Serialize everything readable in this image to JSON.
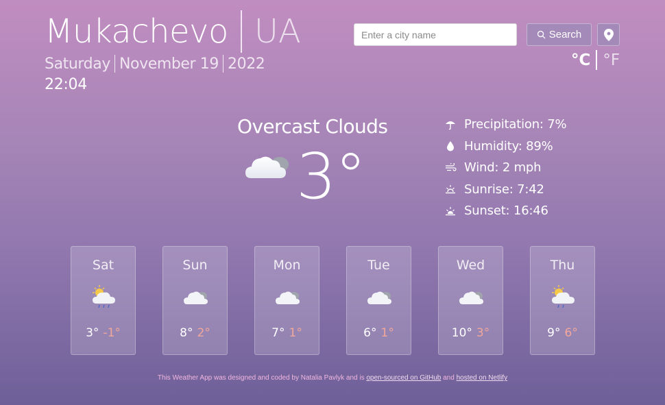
{
  "location": {
    "city": "Mukachevo",
    "country": "UA"
  },
  "date": {
    "weekday": "Saturday",
    "month_day": "November 19",
    "year": "2022",
    "time": "22:04"
  },
  "search": {
    "placeholder": "Enter a city name",
    "button_label": "Search",
    "location_icon": "map-pin-icon"
  },
  "units": {
    "celsius": "°C",
    "fahrenheit": "°F",
    "active": "celsius"
  },
  "current": {
    "description": "Overcast Clouds",
    "temperature": "3°",
    "icon": "cloud-icon",
    "details": [
      {
        "icon": "umbrella-icon",
        "text": "Precipitation: 7%"
      },
      {
        "icon": "droplet-icon",
        "text": "Humidity: 89%"
      },
      {
        "icon": "wind-icon",
        "text": "Wind: 2 mph"
      },
      {
        "icon": "sunrise-icon",
        "text": "Sunrise: 7:42"
      },
      {
        "icon": "sunset-icon",
        "text": "Sunset: 16:46"
      }
    ]
  },
  "forecast": [
    {
      "day": "Sat",
      "high": "3°",
      "low": "-1°",
      "icon": "sun-cloud-rain-icon"
    },
    {
      "day": "Sun",
      "high": "8°",
      "low": "2°",
      "icon": "cloud-icon"
    },
    {
      "day": "Mon",
      "high": "7°",
      "low": "1°",
      "icon": "cloud-icon"
    },
    {
      "day": "Tue",
      "high": "6°",
      "low": "1°",
      "icon": "cloud-icon"
    },
    {
      "day": "Wed",
      "high": "10°",
      "low": "3°",
      "icon": "cloud-icon"
    },
    {
      "day": "Thu",
      "high": "9°",
      "low": "6°",
      "icon": "sun-cloud-rain-icon"
    }
  ],
  "footer": {
    "prefix": "This Weather App was designed and coded by Natalia Pavlyk and is",
    "link1": "open-sourced on GitHub",
    "middle": "and",
    "link2": "hosted on Netlify"
  },
  "colors": {
    "accent_low": "#f3a79a",
    "button": "#a48ab9"
  }
}
